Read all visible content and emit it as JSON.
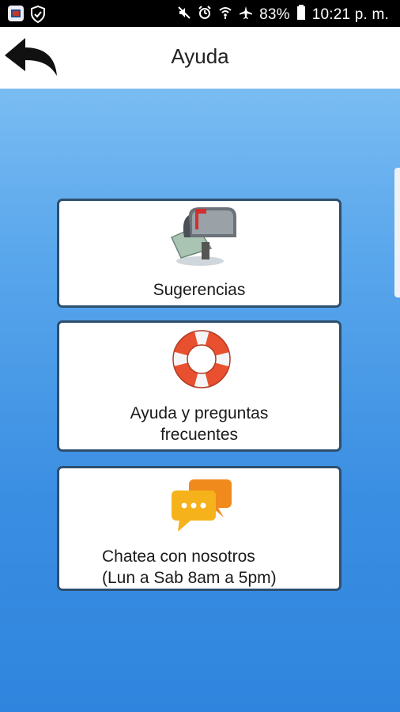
{
  "status_bar": {
    "battery": "83%",
    "time": "10:21 p. m."
  },
  "header": {
    "title": "Ayuda"
  },
  "menu": [
    {
      "label_lines": [
        "Sugerencias"
      ],
      "icon": "mailbox-icon"
    },
    {
      "label_lines": [
        "Ayuda y preguntas",
        "frecuentes"
      ],
      "icon": "lifebuoy-icon"
    },
    {
      "label_lines": [
        "Chatea con nosotros",
        "(Lun a Sab 8am a 5pm)"
      ],
      "icon": "chat-bubbles-icon"
    }
  ]
}
